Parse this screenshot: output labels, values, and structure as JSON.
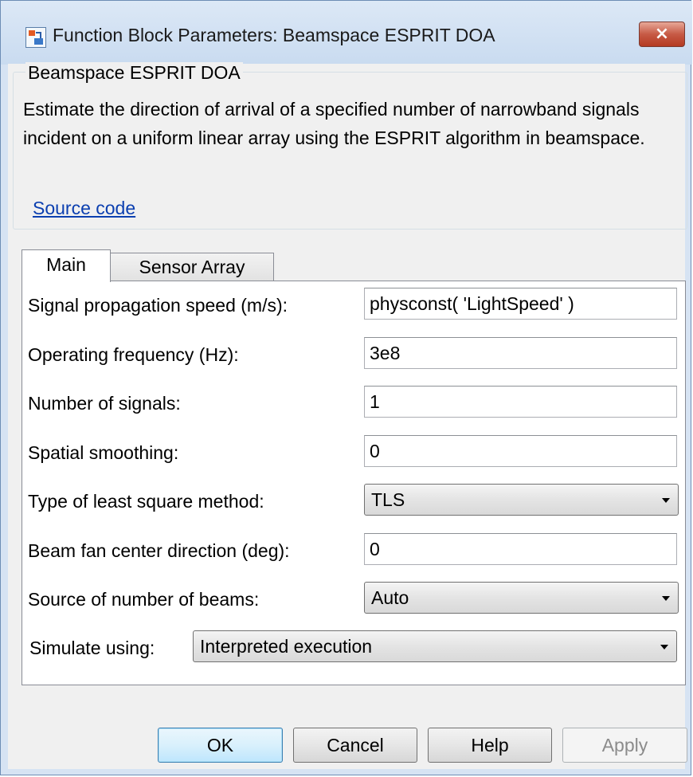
{
  "window": {
    "title": "Function Block Parameters: Beamspace ESPRIT DOA",
    "close_label": "×"
  },
  "block": {
    "name": "Beamspace ESPRIT DOA",
    "description": "Estimate the direction of arrival of a specified number of narrowband signals incident on a uniform linear array using the ESPRIT algorithm in beamspace.",
    "source_link": "Source code"
  },
  "tabs": [
    {
      "label": "Main",
      "selected": true
    },
    {
      "label": "Sensor Array",
      "selected": false
    }
  ],
  "params": {
    "propagation_speed": {
      "label": "Signal propagation speed (m/s):",
      "value": "physconst( 'LightSpeed' )"
    },
    "operating_frequency": {
      "label": "Operating frequency (Hz):",
      "value": "3e8"
    },
    "num_signals": {
      "label": "Number of signals:",
      "value": "1"
    },
    "spatial_smoothing": {
      "label": "Spatial smoothing:",
      "value": "0"
    },
    "least_square_method": {
      "label": "Type of least square method:",
      "value": "TLS"
    },
    "beam_fan_direction": {
      "label": "Beam fan center direction (deg):",
      "value": "0"
    },
    "num_beams_source": {
      "label": "Source of number of beams:",
      "value": "Auto"
    },
    "simulate_using": {
      "label": "Simulate using:",
      "value": "Interpreted execution"
    }
  },
  "buttons": {
    "ok": "OK",
    "cancel": "Cancel",
    "help": "Help",
    "apply": "Apply"
  }
}
